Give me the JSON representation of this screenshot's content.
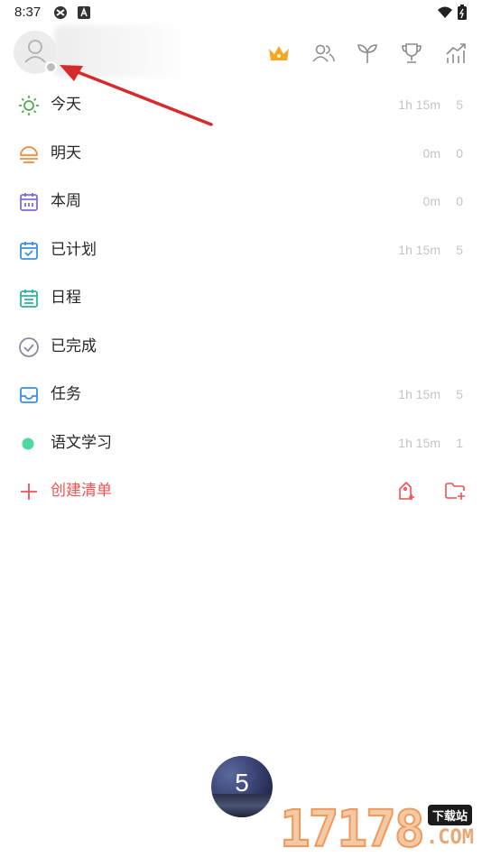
{
  "status_bar": {
    "time": "8:37"
  },
  "header": {
    "avatar_icon": "person-icon",
    "icons": [
      "crown-icon",
      "group-icon",
      "sprout-icon",
      "trophy-icon",
      "stats-chart-icon"
    ],
    "accent_color": "#f5a623"
  },
  "lists": [
    {
      "label": "今天",
      "icon": "sun-icon",
      "color": "#4caf50",
      "duration": "1h 15m",
      "count": "5"
    },
    {
      "label": "明天",
      "icon": "sunset-icon",
      "color": "#f28c3c",
      "duration": "0m",
      "count": "0"
    },
    {
      "label": "本周",
      "icon": "calendar-week-icon",
      "color": "#7b6be0",
      "duration": "0m",
      "count": "0"
    },
    {
      "label": "已计划",
      "icon": "calendar-check-icon",
      "color": "#3a8fe6",
      "duration": "1h 15m",
      "count": "5"
    },
    {
      "label": "日程",
      "icon": "calendar-grid-icon",
      "color": "#2ab59a",
      "duration": "",
      "count": ""
    },
    {
      "label": "已完成",
      "icon": "check-circle-icon",
      "color": "#8a8aa0",
      "duration": "",
      "count": ""
    },
    {
      "label": "任务",
      "icon": "inbox-icon",
      "color": "#3a8fe6",
      "duration": "1h 15m",
      "count": "5"
    },
    {
      "label": "语文学习",
      "icon": "dot-icon",
      "color": "#4dd9a0",
      "duration": "1h 15m",
      "count": "1"
    }
  ],
  "create": {
    "label": "创建清单",
    "color": "#f05252"
  },
  "pomodoro": {
    "value": "5"
  },
  "watermark": {
    "digits": "17178",
    "tag": "下载站",
    "domain": ".COM"
  }
}
